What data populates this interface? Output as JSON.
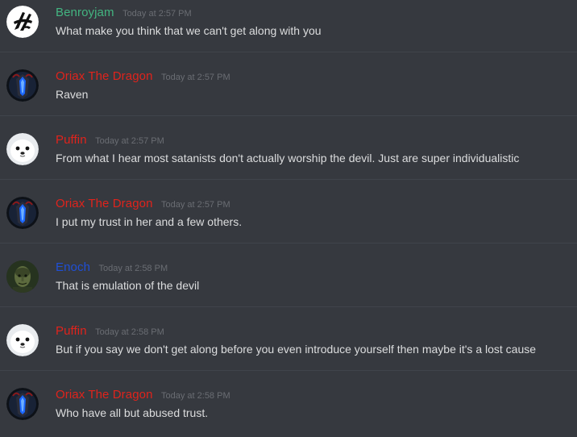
{
  "messages": [
    {
      "author": "Benroyjam",
      "author_color": "#43b581",
      "avatar": "benroyjam-avatar-icon",
      "timestamp": "Today at 2:57 PM",
      "text": "What make you think that we can't get along with you"
    },
    {
      "author": "Oriax The Dragon",
      "author_color": "#e0231c",
      "avatar": "oriax-avatar-icon",
      "timestamp": "Today at 2:57 PM",
      "text": "Raven"
    },
    {
      "author": "Puffin",
      "author_color": "#e0231c",
      "avatar": "puffin-avatar-icon",
      "timestamp": "Today at 2:57 PM",
      "text": "From what I hear most satanists don't actually worship the devil. Just are super individualistic"
    },
    {
      "author": "Oriax The Dragon",
      "author_color": "#e0231c",
      "avatar": "oriax-avatar-icon",
      "timestamp": "Today at 2:57 PM",
      "text": "I put my trust in her and a few others."
    },
    {
      "author": "Enoch",
      "author_color": "#1f4fd6",
      "avatar": "enoch-avatar-icon",
      "timestamp": "Today at 2:58 PM",
      "text": "That is emulation of the devil"
    },
    {
      "author": "Puffin",
      "author_color": "#e0231c",
      "avatar": "puffin-avatar-icon",
      "timestamp": "Today at 2:58 PM",
      "text": "But if you say we don't get along before you even introduce yourself then maybe it's a lost cause"
    },
    {
      "author": "Oriax The Dragon",
      "author_color": "#e0231c",
      "avatar": "oriax-avatar-icon",
      "timestamp": "Today at 2:58 PM",
      "text": "Who have all but abused trust."
    }
  ]
}
